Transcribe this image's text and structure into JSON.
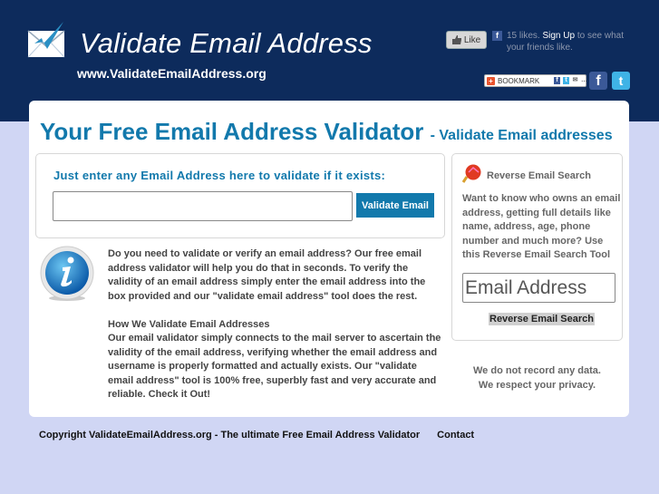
{
  "header": {
    "logo_icon": "envelope-check-icon",
    "title": "Validate Email Address",
    "url": "www.ValidateEmailAddress.org",
    "facebook_like": {
      "button_label": "Like",
      "count_text": "15 likes.",
      "signup_label": "Sign Up",
      "suffix_text": "to see what your friends like."
    },
    "bookmark_label": "BOOKMARK",
    "social": [
      "facebook-icon",
      "twitter-icon"
    ]
  },
  "main": {
    "title": "Your Free Email Address Validator",
    "subtitle": "- Validate Email addresses",
    "entry_label": "Just enter any Email Address here to validate if it exists:",
    "email_input": {
      "value": "",
      "placeholder": ""
    },
    "validate_button": "Validate Email",
    "description": [
      "Do you need to validate or verify an email address? Our free email address validator will help you do that in seconds. To verify the validity of an email address simply enter the email address into the box provided and our \"validate email address\" tool does the rest.",
      "How We Validate Email Addresses",
      "Our email validator simply connects to the mail server to ascertain the validity of the email address, verifying whether the email address and username is properly formatted and actually exists. Our \"validate email address\" tool is 100% free, superbly fast and very accurate and reliable. Check it Out!"
    ]
  },
  "sidebar": {
    "title": "Reverse Email Search",
    "description": "Want to know who owns an email address, getting full details like name, address, age, phone number and much more? Use this Reverse Email Search Tool",
    "input": {
      "value": "",
      "placeholder": "Email Address"
    },
    "button": "Reverse Email Search",
    "privacy_line1": "We do not record any data.",
    "privacy_line2": "We respect your privacy."
  },
  "footer": {
    "copyright": "Copyright ValidateEmailAddress.org - The ultimate Free Email Address Validator",
    "contact": "Contact"
  },
  "colors": {
    "header_bg": "#0d2b5c",
    "page_bg": "#d0d6f4",
    "accent": "#1279ac"
  }
}
